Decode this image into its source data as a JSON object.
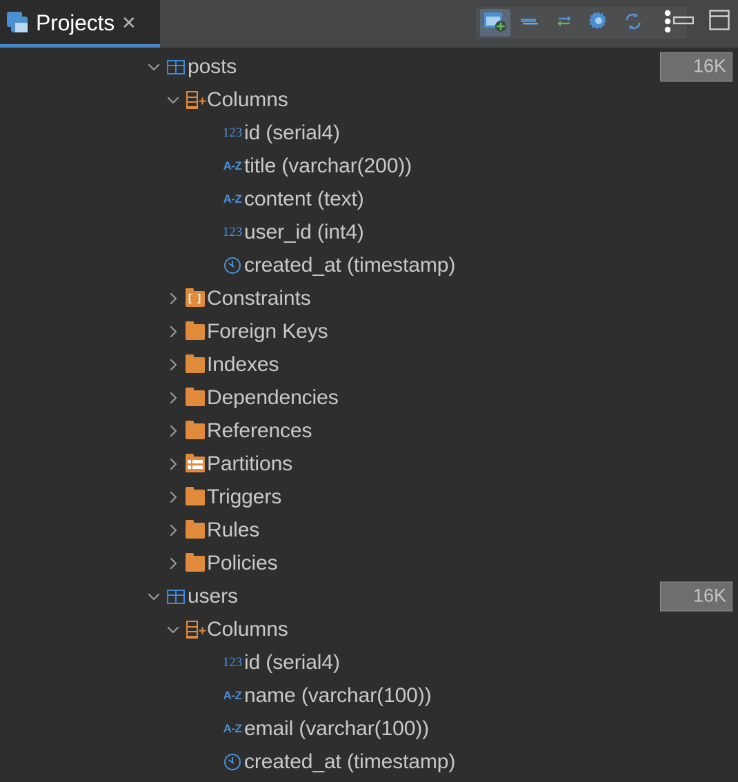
{
  "tab": {
    "label": "Projects",
    "icon": "projects-icon",
    "close_label": "✕"
  },
  "toolbar": {
    "buttons": [
      {
        "name": "new-data-source-button",
        "icon": "new-window-plus-icon",
        "active": true
      },
      {
        "name": "collapse-all-button",
        "icon": "collapse-bar-icon",
        "active": false
      },
      {
        "name": "synchronize-arrows-button",
        "icon": "bidirectional-arrows-icon",
        "active": false
      },
      {
        "name": "settings-button",
        "icon": "gear-icon",
        "active": false
      },
      {
        "name": "refresh-button",
        "icon": "refresh-icon",
        "active": false
      },
      {
        "name": "more-options-button",
        "icon": "vertical-dots-icon",
        "active": false
      }
    ],
    "window_controls": [
      {
        "name": "minimize-button",
        "icon": "minimize-icon"
      },
      {
        "name": "restore-layout-button",
        "icon": "window-layout-icon"
      }
    ]
  },
  "tree": {
    "rows": [
      {
        "level": 1,
        "arrow": "˅",
        "icon": "table-icon",
        "label": "posts",
        "badge": "16K"
      },
      {
        "level": 2,
        "arrow": "˅",
        "icon": "columns-icon",
        "label": "Columns",
        "badge": ""
      },
      {
        "level": 3,
        "arrow": "",
        "icon": "numeric-icon",
        "label": "id (serial4)",
        "badge": ""
      },
      {
        "level": 3,
        "arrow": "",
        "icon": "text-icon",
        "label": "title (varchar(200))",
        "badge": ""
      },
      {
        "level": 3,
        "arrow": "",
        "icon": "text-icon",
        "label": "content (text)",
        "badge": ""
      },
      {
        "level": 3,
        "arrow": "",
        "icon": "numeric-icon",
        "label": "user_id (int4)",
        "badge": ""
      },
      {
        "level": 3,
        "arrow": "",
        "icon": "timestamp-icon",
        "label": "created_at (timestamp)",
        "badge": ""
      },
      {
        "level": 2,
        "arrow": "›",
        "icon": "constraints-icon",
        "label": "Constraints",
        "badge": ""
      },
      {
        "level": 2,
        "arrow": "›",
        "icon": "folder-icon",
        "label": "Foreign Keys",
        "badge": ""
      },
      {
        "level": 2,
        "arrow": "›",
        "icon": "folder-icon",
        "label": "Indexes",
        "badge": ""
      },
      {
        "level": 2,
        "arrow": "›",
        "icon": "folder-icon",
        "label": "Dependencies",
        "badge": ""
      },
      {
        "level": 2,
        "arrow": "›",
        "icon": "folder-icon",
        "label": "References",
        "badge": ""
      },
      {
        "level": 2,
        "arrow": "›",
        "icon": "partitions-icon",
        "label": "Partitions",
        "badge": ""
      },
      {
        "level": 2,
        "arrow": "›",
        "icon": "folder-icon",
        "label": "Triggers",
        "badge": ""
      },
      {
        "level": 2,
        "arrow": "›",
        "icon": "folder-icon",
        "label": "Rules",
        "badge": ""
      },
      {
        "level": 2,
        "arrow": "›",
        "icon": "folder-icon",
        "label": "Policies",
        "badge": ""
      },
      {
        "level": 1,
        "arrow": "˅",
        "icon": "table-icon",
        "label": "users",
        "badge": "16K"
      },
      {
        "level": 2,
        "arrow": "˅",
        "icon": "columns-icon",
        "label": "Columns",
        "badge": ""
      },
      {
        "level": 3,
        "arrow": "",
        "icon": "numeric-icon",
        "label": "id (serial4)",
        "badge": ""
      },
      {
        "level": 3,
        "arrow": "",
        "icon": "text-icon",
        "label": "name (varchar(100))",
        "badge": ""
      },
      {
        "level": 3,
        "arrow": "",
        "icon": "text-icon",
        "label": "email (varchar(100))",
        "badge": ""
      },
      {
        "level": 3,
        "arrow": "",
        "icon": "timestamp-icon",
        "label": "created_at (timestamp)",
        "badge": ""
      }
    ]
  },
  "colors": {
    "background": "#2e2e2e",
    "header": "#454648",
    "tab_active": "#2b2b2b",
    "tab_underline": "#4a88c7",
    "text": "#c9c9c9",
    "accent_blue": "#3f8ad8",
    "accent_orange": "#e08a3c",
    "badge_bg": "#6e6e6e"
  },
  "icon_glyphs": {
    "numeric": "123",
    "text": "A-Z",
    "brackets": "[ ]"
  }
}
